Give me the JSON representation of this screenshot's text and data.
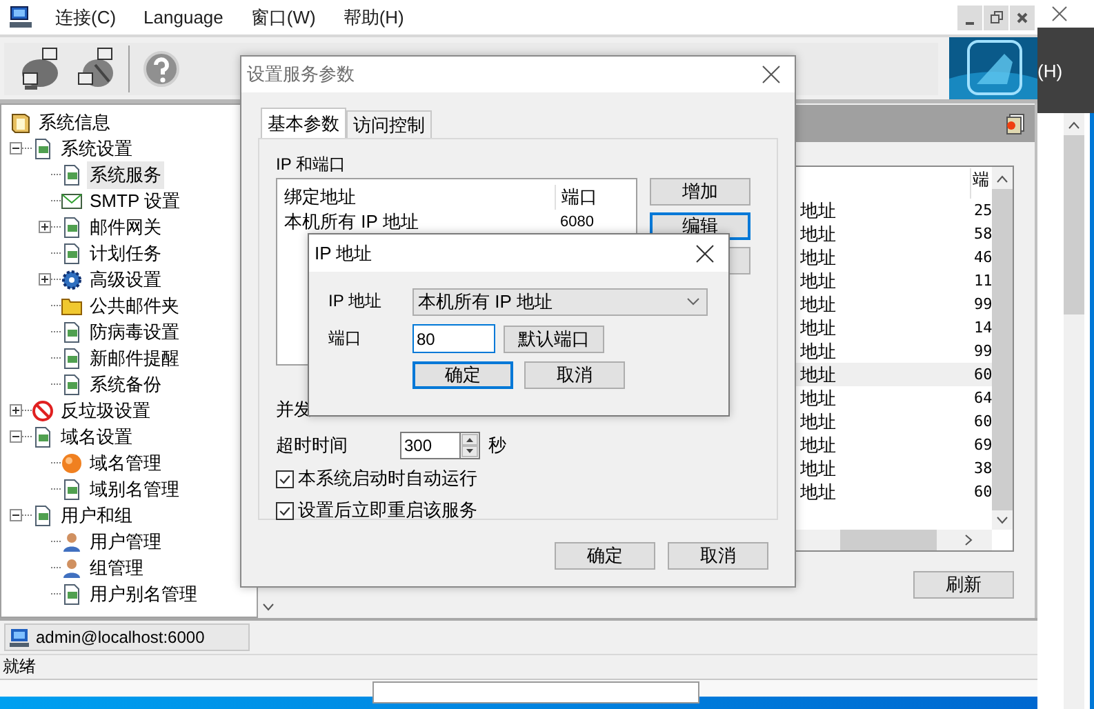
{
  "menu": [
    "连接(C)",
    "Language",
    "窗口(W)",
    "帮助(H)"
  ],
  "side_window": {
    "menu_fragment": "(H)"
  },
  "tree": [
    {
      "label": "系统信息",
      "selected": false
    },
    {
      "label": "系统设置",
      "selected": false,
      "expanded": true,
      "children": [
        {
          "label": "系统服务",
          "selected": true
        },
        {
          "label": "SMTP 设置",
          "selected": false
        },
        {
          "label": "邮件网关",
          "selected": false,
          "expanded": false
        },
        {
          "label": "计划任务",
          "selected": false
        },
        {
          "label": "高级设置",
          "selected": false,
          "expanded": false
        },
        {
          "label": "公共邮件夹",
          "selected": false
        },
        {
          "label": "防病毒设置",
          "selected": false
        },
        {
          "label": "新邮件提醒",
          "selected": false
        },
        {
          "label": "系统备份",
          "selected": false
        }
      ]
    },
    {
      "label": "反垃圾设置",
      "selected": false,
      "expanded": false
    },
    {
      "label": "域名设置",
      "selected": false,
      "expanded": true,
      "children": [
        {
          "label": "域名管理",
          "selected": false
        },
        {
          "label": "域别名管理",
          "selected": false
        }
      ]
    },
    {
      "label": "用户和组",
      "selected": false,
      "expanded": true,
      "children": [
        {
          "label": "用户管理",
          "selected": false
        },
        {
          "label": "组管理",
          "selected": false
        },
        {
          "label": "用户别名管理",
          "selected": false
        }
      ]
    }
  ],
  "service_list": {
    "port_header": "端",
    "rows": [
      {
        "address": "地址",
        "port": "25",
        "selected": false
      },
      {
        "address": "地址",
        "port": "58",
        "selected": false
      },
      {
        "address": "地址",
        "port": "46",
        "selected": false
      },
      {
        "address": "地址",
        "port": "11",
        "selected": false
      },
      {
        "address": "地址",
        "port": "99",
        "selected": false
      },
      {
        "address": "地址",
        "port": "14",
        "selected": false
      },
      {
        "address": "地址",
        "port": "99",
        "selected": false
      },
      {
        "address": "地址",
        "port": "60",
        "selected": true
      },
      {
        "address": "地址",
        "port": "64",
        "selected": false
      },
      {
        "address": "地址",
        "port": "60",
        "selected": false
      },
      {
        "address": "地址",
        "port": "69",
        "selected": false
      },
      {
        "address": "地址",
        "port": "38",
        "selected": false
      },
      {
        "address": "地址",
        "port": "60",
        "selected": false
      }
    ]
  },
  "refresh_button": "刷新",
  "session": "admin@localhost:6000",
  "status_bar": "就绪",
  "service_dialog": {
    "title": "设置服务参数",
    "tabs": [
      {
        "label": "基本参数",
        "selected": true
      },
      {
        "label": "访问控制",
        "selected": false
      }
    ],
    "group_label": "IP 和端口",
    "bind_columns": [
      "绑定地址",
      "端口"
    ],
    "bind_rows": [
      {
        "address": "本机所有 IP 地址",
        "port": "6080"
      }
    ],
    "side_buttons": [
      {
        "label": "增加",
        "focused": false
      },
      {
        "label": "编辑",
        "focused": true
      }
    ],
    "concurrency_label": "并发",
    "timeout_label": "超时时间",
    "timeout_value": "300",
    "timeout_unit": "秒",
    "checkboxes": [
      {
        "label": "本系统启动时自动运行",
        "checked": true
      },
      {
        "label": "设置后立即重启该服务",
        "checked": true
      }
    ],
    "buttons": [
      "确定",
      "取消"
    ]
  },
  "ip_dialog": {
    "title": "IP 地址",
    "ip_label": "IP 地址",
    "ip_value": "本机所有 IP 地址",
    "port_label": "端口",
    "port_value": "80",
    "default_port_button": "默认端口",
    "buttons": [
      {
        "label": "确定",
        "focused": true
      },
      {
        "label": "取消",
        "focused": false
      }
    ]
  }
}
